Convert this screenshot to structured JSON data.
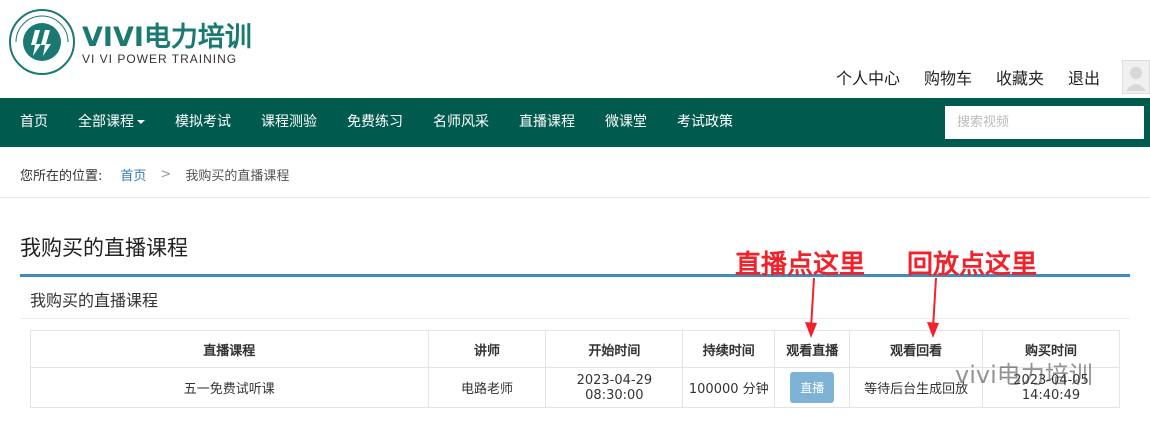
{
  "header": {
    "logo_cn": "VIVI电力培训",
    "logo_en": "VI VI POWER TRAINING",
    "user_links": [
      "个人中心",
      "购物车",
      "收藏夹",
      "退出"
    ]
  },
  "nav": {
    "items": [
      "首页",
      "全部课程",
      "模拟考试",
      "课程测验",
      "免费练习",
      "名师风采",
      "直播课程",
      "微课堂",
      "考试政策"
    ],
    "search_placeholder": "搜索视频"
  },
  "breadcrumb": {
    "label": "您所在的位置:",
    "home": "首页",
    "separator": ">",
    "current": "我购买的直播课程"
  },
  "page": {
    "title": "我购买的直播课程",
    "panel_title": "我购买的直播课程"
  },
  "table": {
    "headers": [
      "直播课程",
      "讲师",
      "开始时间",
      "持续时间",
      "观看直播",
      "观看回看",
      "购买时间"
    ],
    "rows": [
      {
        "course": "五一免费试听课",
        "teacher": "电路老师",
        "start": "2023-04-29 08:30:00",
        "duration": "100000 分钟",
        "live_button": "直播",
        "replay": "等待后台生成回放",
        "purchase": "2023-04-05 14:40:49"
      }
    ]
  },
  "annotations": {
    "live": "直播点这里",
    "replay": "回放点这里",
    "color": "#f2222b"
  },
  "watermark": "vivi电力培训",
  "colors": {
    "nav_bg": "#005a4e",
    "brand": "#1a7a72",
    "title_rule": "#3f8dbf",
    "live_button": "#7fb3d5"
  }
}
